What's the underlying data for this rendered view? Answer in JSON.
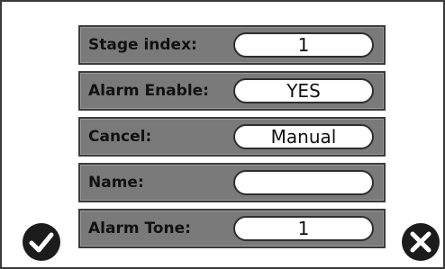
{
  "form": {
    "fields": [
      {
        "label": "Stage index:",
        "value": "1"
      },
      {
        "label": "Alarm Enable:",
        "value": "YES"
      },
      {
        "label": "Cancel:",
        "value": "Manual"
      },
      {
        "label": "Name:",
        "value": ""
      },
      {
        "label": "Alarm Tone:",
        "value": "1"
      }
    ]
  },
  "actions": {
    "confirm_icon": "check-icon",
    "cancel_icon": "close-icon"
  },
  "colors": {
    "row_background": "#7a7a7a",
    "row_border": "#3c3c3c",
    "value_background": "#ffffff",
    "icon_fill": "#1c1c1c"
  }
}
